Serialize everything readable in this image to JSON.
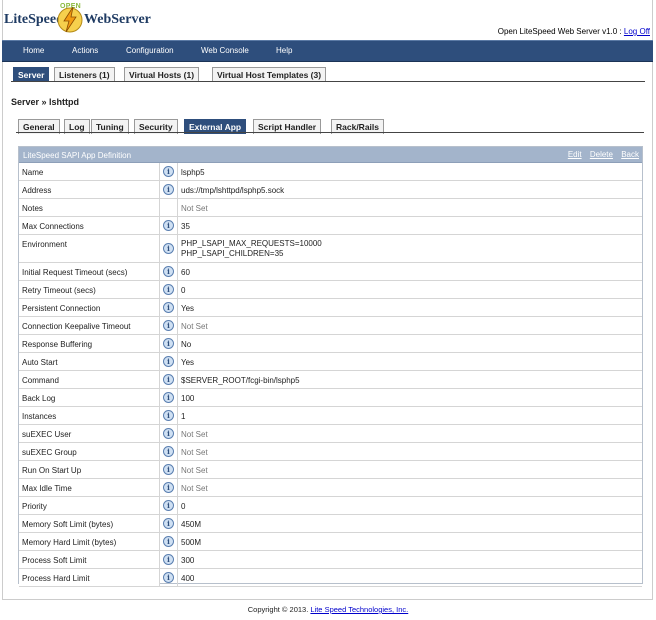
{
  "header": {
    "logo_open": "OPEN",
    "logo_brand1": "LiteSpeed",
    "logo_brand2": "WebServer",
    "version_text": "Open LiteSpeed Web Server v1.0 :",
    "logout_label": "Log Off"
  },
  "nav": {
    "items": [
      "Home",
      "Actions",
      "Configuration",
      "Web Console",
      "Help"
    ]
  },
  "top_tabs": [
    "Server",
    "Listeners (1)",
    "Virtual Hosts (1)",
    "Virtual Host Templates (3)"
  ],
  "breadcrumb": "Server » lshttpd",
  "sub_tabs": [
    "General",
    "Log",
    "Tuning",
    "Security",
    "External App",
    "Script Handler",
    "Rack/Rails"
  ],
  "panel": {
    "title": "LiteSpeed SAPI App Definition",
    "actions": [
      "Edit",
      "Delete",
      "Back"
    ],
    "rows": [
      {
        "label": "Name",
        "value": "lsphp5",
        "help": true
      },
      {
        "label": "Address",
        "value": "uds://tmp/lshttpd/lsphp5.sock",
        "help": true
      },
      {
        "label": "Notes",
        "value": "Not Set",
        "help": false,
        "notset": true
      },
      {
        "label": "Max Connections",
        "value": "35",
        "help": true
      },
      {
        "label": "Environment",
        "value": "PHP_LSAPI_MAX_REQUESTS=10000\nPHP_LSAPI_CHILDREN=35",
        "help": true,
        "tall": true
      },
      {
        "label": "Initial Request Timeout (secs)",
        "value": "60",
        "help": true
      },
      {
        "label": "Retry Timeout (secs)",
        "value": "0",
        "help": true
      },
      {
        "label": "Persistent Connection",
        "value": "Yes",
        "help": true
      },
      {
        "label": "Connection Keepalive Timeout",
        "value": "Not Set",
        "help": true,
        "notset": true
      },
      {
        "label": "Response Buffering",
        "value": "No",
        "help": true
      },
      {
        "label": "Auto Start",
        "value": "Yes",
        "help": true
      },
      {
        "label": "Command",
        "value": "$SERVER_ROOT/fcgi-bin/lsphp5",
        "help": true
      },
      {
        "label": "Back Log",
        "value": "100",
        "help": true
      },
      {
        "label": "Instances",
        "value": "1",
        "help": true
      },
      {
        "label": "suEXEC User",
        "value": "Not Set",
        "help": true,
        "notset": true
      },
      {
        "label": "suEXEC Group",
        "value": "Not Set",
        "help": true,
        "notset": true
      },
      {
        "label": "Run On Start Up",
        "value": "Not Set",
        "help": true,
        "notset": true
      },
      {
        "label": "Max Idle Time",
        "value": "Not Set",
        "help": true,
        "notset": true
      },
      {
        "label": "Priority",
        "value": "0",
        "help": true
      },
      {
        "label": "Memory Soft Limit (bytes)",
        "value": "450M",
        "help": true
      },
      {
        "label": "Memory Hard Limit (bytes)",
        "value": "500M",
        "help": true
      },
      {
        "label": "Process Soft Limit",
        "value": "300",
        "help": true
      },
      {
        "label": "Process Hard Limit",
        "value": "400",
        "help": true
      }
    ]
  },
  "footer": {
    "copyright": "Copyright © 2013.",
    "company_link": "Lite Speed Technologies, Inc."
  },
  "colors": {
    "nav_bg": "#2e4e7c",
    "panel_head_bg": "#a3b4cb",
    "link": "#0000cc"
  },
  "icons": {
    "logo": "lightning-bolt-icon",
    "help": "info-icon"
  }
}
